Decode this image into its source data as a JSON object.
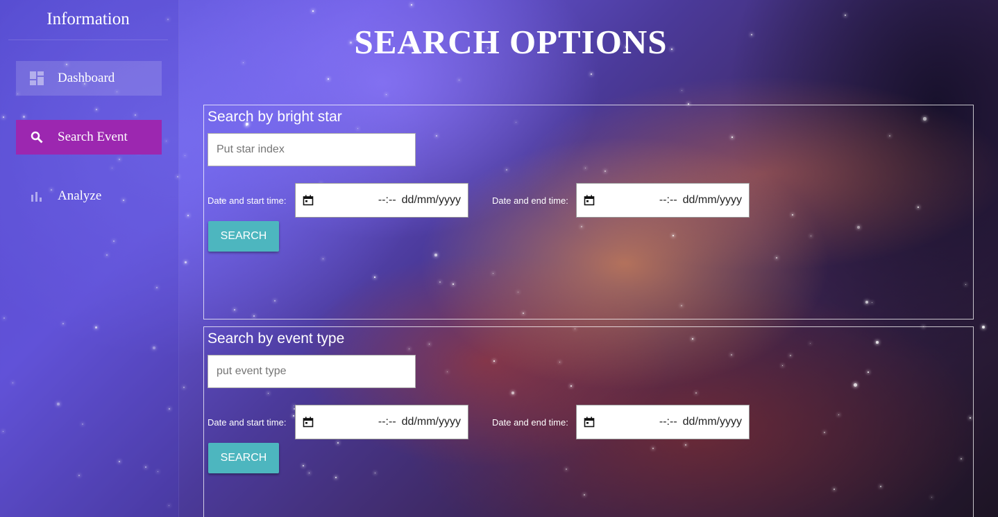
{
  "sidebar": {
    "title": "Information",
    "items": [
      {
        "label": "Dashboard",
        "icon": "dashboard-icon"
      },
      {
        "label": "Search Event",
        "icon": "search-icon",
        "active": true
      },
      {
        "label": "Analyze",
        "icon": "bar-chart-icon"
      }
    ]
  },
  "main": {
    "title": "SEARCH OPTIONS",
    "panels": [
      {
        "title": "Search by bright star",
        "input_placeholder": "Put star index",
        "start_label": "Date and start time:",
        "start_time": "--:--",
        "start_date": "dd/mm/yyyy",
        "end_label": "Date and end time:",
        "end_time": "--:--",
        "end_date": "dd/mm/yyyy",
        "button_label": "SEARCH"
      },
      {
        "title": "Search by event type",
        "input_placeholder": "put event type",
        "start_label": "Date and start time:",
        "start_time": "--:--",
        "start_date": "dd/mm/yyyy",
        "end_label": "Date and end time:",
        "end_time": "--:--",
        "end_date": "dd/mm/yyyy",
        "button_label": "SEARCH"
      }
    ]
  },
  "colors": {
    "active_nav": "#9c27b0",
    "search_button": "#4db6bf"
  }
}
